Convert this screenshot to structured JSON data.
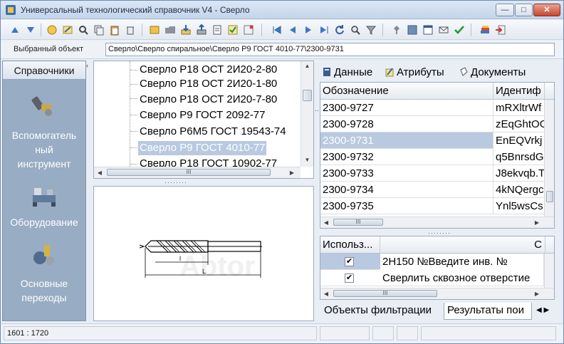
{
  "window": {
    "title": "Универсальный технологический справочник V4 - Сверло",
    "min_label": "—",
    "max_label": "□",
    "close_label": "✕"
  },
  "selected_object": {
    "label": "Выбранный объект",
    "value": "Сверло\\Сверло спиральное\\Сверло Р9 ГОСТ 4010-77\\2300-9731"
  },
  "sidebar": {
    "header": "Справочники",
    "items": [
      {
        "label_lines": [
          "Вспомогатель",
          "ный",
          "инструмент"
        ],
        "icon": "tool-holder-icon"
      },
      {
        "label_lines": [
          "Оборудование"
        ],
        "icon": "lathe-machine-icon"
      },
      {
        "label_lines": [
          "Основные",
          "переходы"
        ],
        "icon": "machining-transition-icon"
      }
    ]
  },
  "tree": {
    "items": [
      {
        "label": "Сверло  Р18  ОСТ  2И20-2-80",
        "selected": false
      },
      {
        "label": "Сверло  Р18  ОСТ  2И20-1-80",
        "selected": false
      },
      {
        "label": "Сверло  Р18  ОСТ  2И20-7-80",
        "selected": false
      },
      {
        "label": "Сверло  Р9  ГОСТ  2092-77",
        "selected": false
      },
      {
        "label": "Сверло  Р6М5  ГОСТ  19543-74",
        "selected": false
      },
      {
        "label": "Сверло  Р9  ГОСТ  4010-77",
        "selected": true
      },
      {
        "label": "Сверло  Р18  ГОСТ  10902-77",
        "selected": false
      }
    ],
    "hscroll_thumb": "III"
  },
  "tabs": {
    "data": "Данные",
    "attributes": "Атрибуты",
    "documents": "Документы"
  },
  "grid": {
    "columns": [
      "Обозначение",
      "Идентиф"
    ],
    "rows": [
      {
        "designation": "2300-9727",
        "id": "mRXltrWf",
        "selected": false
      },
      {
        "designation": "2300-9728",
        "id": "zEqGhtOG",
        "selected": false
      },
      {
        "designation": "2300-9731",
        "id": "EnEQVrkj",
        "selected": true
      },
      {
        "designation": "2300-9732",
        "id": "q5BnrsdG",
        "selected": false
      },
      {
        "designation": "2300-9733",
        "id": "J8ekvqb.T",
        "selected": false
      },
      {
        "designation": "2300-9734",
        "id": "4kNQergc",
        "selected": false
      },
      {
        "designation": "2300-9735",
        "id": "Ynl5wsCs",
        "selected": false
      }
    ],
    "hscroll_thumb": "III"
  },
  "usage": {
    "columns": [
      "Использ...",
      "С"
    ],
    "rows": [
      {
        "checked": true,
        "text": "2Н150  №Введите  инв.  №"
      },
      {
        "checked": true,
        "text": "Сверлить  сквозное  отверстие"
      }
    ],
    "hscroll_thumb": "III",
    "check_mark": "✔"
  },
  "bottom_tabs": {
    "filter": "Объекты  фильтрации",
    "results": "Результаты  пои"
  },
  "drawing": {
    "watermark": "Abtor",
    "dim_inner": "l",
    "dim_outer": "L"
  },
  "status": {
    "coords": "1601 : 1720"
  },
  "colors": {
    "selection": "#b8c9e0",
    "sidebar": "#98acc3"
  }
}
